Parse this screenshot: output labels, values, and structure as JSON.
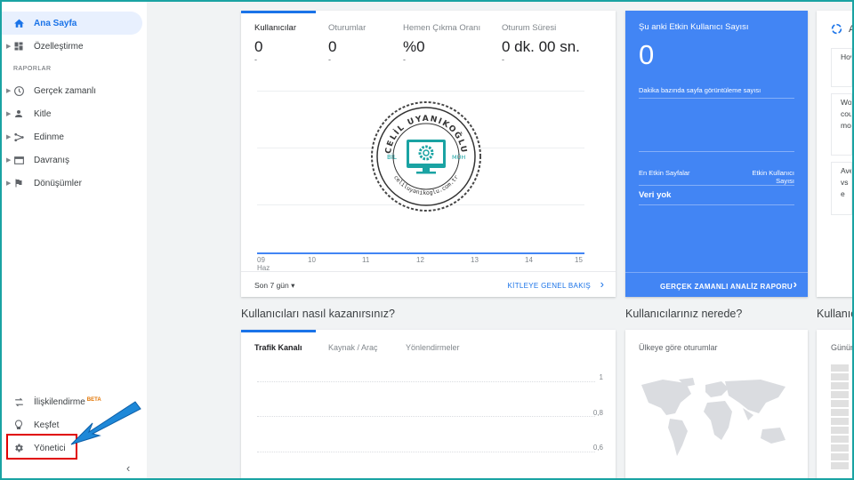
{
  "sidebar": {
    "home": "Ana Sayfa",
    "customize": "Özelleştirme",
    "section": "RAPORLAR",
    "reports": [
      "Gerçek zamanlı",
      "Kitle",
      "Edinme",
      "Davranış",
      "Dönüşümler"
    ],
    "linking": "İlişkilendirme",
    "beta": "BETA",
    "discover": "Keşfet",
    "admin": "Yönetici"
  },
  "overview": {
    "metrics": [
      {
        "label": "Kullanıcılar",
        "value": "0"
      },
      {
        "label": "Oturumlar",
        "value": "0"
      },
      {
        "label": "Hemen Çıkma Oranı",
        "value": "%0"
      },
      {
        "label": "Oturum Süresi",
        "value": "0 dk. 00 sn."
      }
    ],
    "metric_dash": "-",
    "dates": [
      "09",
      "10",
      "11",
      "12",
      "13",
      "14",
      "15"
    ],
    "month": "Haz",
    "range": "Son 7 gün",
    "link": "KİTLEYE GENEL BAKIŞ"
  },
  "realtime": {
    "title": "Şu anki Etkin Kullanıcı Sayısı",
    "value": "0",
    "subtitle": "Dakika bazında sayfa görüntüleme sayısı",
    "col_pages": "En Etkin Sayfalar",
    "col_users": "Etkin Kullanıcı Sayısı",
    "empty": "Veri yok",
    "link": "GERÇEK ZAMANLI ANALİZ RAPORU"
  },
  "acquisition": {
    "heading": "Kullanıcıları nasıl kazanırsınız?",
    "tabs": [
      "Trafik Kanalı",
      "Kaynak / Araç",
      "Yönlendirmeler"
    ],
    "yticks": [
      "1",
      "0,8",
      "0,6"
    ]
  },
  "location": {
    "heading": "Kullanıcılarınız nerede?",
    "subtitle": "Ülkeye göre oturumlar"
  },
  "cut": {
    "heading3": "Kullanıcı",
    "sub3": "Günün",
    "insight_title": "A",
    "insights": [
      "Hov",
      "Wo cou mo",
      "Ave vs e"
    ]
  },
  "watermark": {
    "top": "CELİL UYANIKOĞLU",
    "bottom": "celiluyanikoglu.com.tr",
    "left": "BİL",
    "right": "MÜH"
  },
  "colors": {
    "accent": "#1a73e8",
    "realtime_bg": "#4285f4",
    "highlight": "#e00000",
    "arrow": "#1e88d8"
  }
}
